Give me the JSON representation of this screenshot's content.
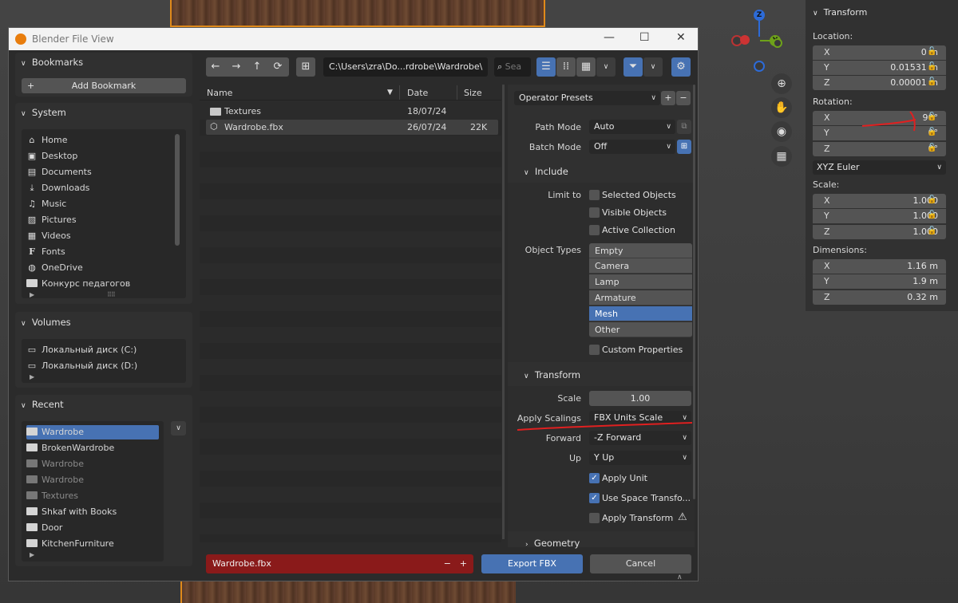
{
  "window": {
    "title": "Blender File View"
  },
  "bookmarks": {
    "header": "Bookmarks",
    "add_label": "Add Bookmark"
  },
  "system": {
    "header": "System",
    "items": [
      {
        "label": "Home"
      },
      {
        "label": "Desktop"
      },
      {
        "label": "Documents"
      },
      {
        "label": "Downloads"
      },
      {
        "label": "Music"
      },
      {
        "label": "Pictures"
      },
      {
        "label": "Videos"
      },
      {
        "label": "Fonts"
      },
      {
        "label": "OneDrive"
      },
      {
        "label": "Конкурс педагогов"
      }
    ]
  },
  "volumes": {
    "header": "Volumes",
    "items": [
      {
        "label": "Локальный диск (C:)"
      },
      {
        "label": "Локальный диск (D:)"
      }
    ]
  },
  "recent": {
    "header": "Recent",
    "items": [
      {
        "label": "Wardrobe",
        "selected": true
      },
      {
        "label": "BrokenWardrobe"
      },
      {
        "label": "Wardrobe",
        "dim": true
      },
      {
        "label": "Wardrobe",
        "dim": true
      },
      {
        "label": "Textures",
        "dim": true
      },
      {
        "label": "Shkaf with Books"
      },
      {
        "label": "Door"
      },
      {
        "label": "KitchenFurniture"
      }
    ]
  },
  "toolbar": {
    "path": "C:\\Users\\zra\\Do...rdrobe\\Wardrobe\\",
    "search_placeholder": "Sea"
  },
  "filelist": {
    "columns": {
      "name": "Name",
      "date": "Date",
      "size": "Size"
    },
    "rows": [
      {
        "name": "Textures",
        "date": "18/07/24",
        "size": ""
      },
      {
        "name": "Wardrobe.fbx",
        "date": "26/07/24",
        "size": "22K"
      }
    ]
  },
  "props": {
    "operator_presets": "Operator Presets",
    "path_mode": {
      "label": "Path Mode",
      "value": "Auto"
    },
    "batch_mode": {
      "label": "Batch Mode",
      "value": "Off"
    },
    "include": {
      "header": "Include",
      "limit_to": "Limit to",
      "selected_objects": "Selected Objects",
      "visible_objects": "Visible Objects",
      "active_collection": "Active Collection",
      "object_types_label": "Object Types",
      "object_types": [
        "Empty",
        "Camera",
        "Lamp",
        "Armature",
        "Mesh",
        "Other"
      ],
      "custom_properties": "Custom Properties"
    },
    "transform": {
      "header": "Transform",
      "scale_label": "Scale",
      "scale_value": "1.00",
      "apply_scalings_label": "Apply Scalings",
      "apply_scalings_value": "FBX Units Scale",
      "forward_label": "Forward",
      "forward_value": "-Z Forward",
      "up_label": "Up",
      "up_value": "Y Up",
      "apply_unit": "Apply Unit",
      "use_space_transform": "Use Space Transfo...",
      "apply_transform": "Apply Transform"
    },
    "geometry": {
      "header": "Geometry"
    }
  },
  "footer": {
    "filename": "Wardrobe.fbx",
    "export_label": "Export FBX",
    "cancel_label": "Cancel"
  },
  "npanel": {
    "header": "Transform",
    "location_label": "Location:",
    "location": {
      "x": "0 m",
      "y": "0.01531 m",
      "z": "0.00001 m"
    },
    "rotation_label": "Rotation:",
    "rotation": {
      "x": "90°",
      "y": "0°",
      "z": "0°"
    },
    "rotation_mode": "XYZ Euler",
    "scale_label": "Scale:",
    "scale": {
      "x": "1.000",
      "y": "1.000",
      "z": "1.000"
    },
    "dimensions_label": "Dimensions:",
    "dimensions": {
      "x": "1.16 m",
      "y": "1.9 m",
      "z": "0.32 m"
    },
    "axis_x": "X",
    "axis_y": "Y",
    "axis_z": "Z"
  },
  "gizmo": {
    "z_label": "Z",
    "y_label": "Y"
  },
  "colors": {
    "accent": "#4772b3",
    "annotation_red": "#e02020",
    "filename_bg": "#8a1a1a"
  }
}
